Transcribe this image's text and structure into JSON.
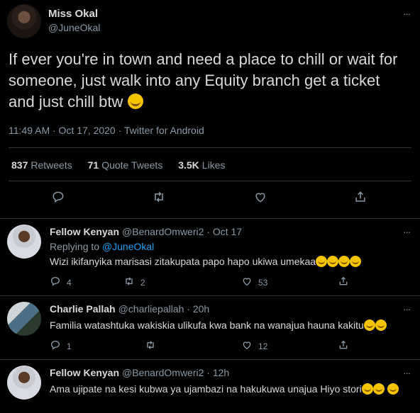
{
  "tweet": {
    "name": "Miss Okal",
    "handle": "@JuneOkal",
    "text": "If ever you're in town and need a place to chill or wait for someone, just walk into any Equity branch get a ticket and just chill btw",
    "meta": "11:49 AM · Oct 17, 2020 · Twitter for Android",
    "stats": {
      "retweets_num": "837",
      "retweets_label": "Retweets",
      "quotes_num": "71",
      "quotes_label": "Quote Tweets",
      "likes_num": "3.5K",
      "likes_label": "Likes"
    },
    "more": "···"
  },
  "replies": [
    {
      "name": "Fellow Kenyan",
      "handle": "@BenardOmweri2 · Oct 17",
      "replying_prefix": "Replying to",
      "replying_to": "@JuneOkal",
      "text": "Wizi ikifanyika marisasi zitakupata papo hapo ukiwa umekaa",
      "replies_count": "4",
      "retweets_count": "2",
      "likes_count": "53"
    },
    {
      "name": "Charlie Pallah",
      "handle": "@charliepallah · 20h",
      "text": "Familia watashtuka wakiskia ulikufa kwa bank na wanajua hauna kakitu",
      "replies_count": "1",
      "retweets_count": "",
      "likes_count": "12"
    },
    {
      "name": "Fellow Kenyan",
      "handle": "@BenardOmweri2 · 12h",
      "text": "Ama ujipate na kesi kubwa ya ujambazi na hakukuwa unajua Hiyo stori"
    }
  ],
  "icons": {
    "reply": "reply-icon",
    "retweet": "retweet-icon",
    "like": "like-icon",
    "share": "share-icon"
  },
  "colors": {
    "background": "#000000",
    "link": "#1da1f2",
    "muted": "#8b98a5"
  }
}
